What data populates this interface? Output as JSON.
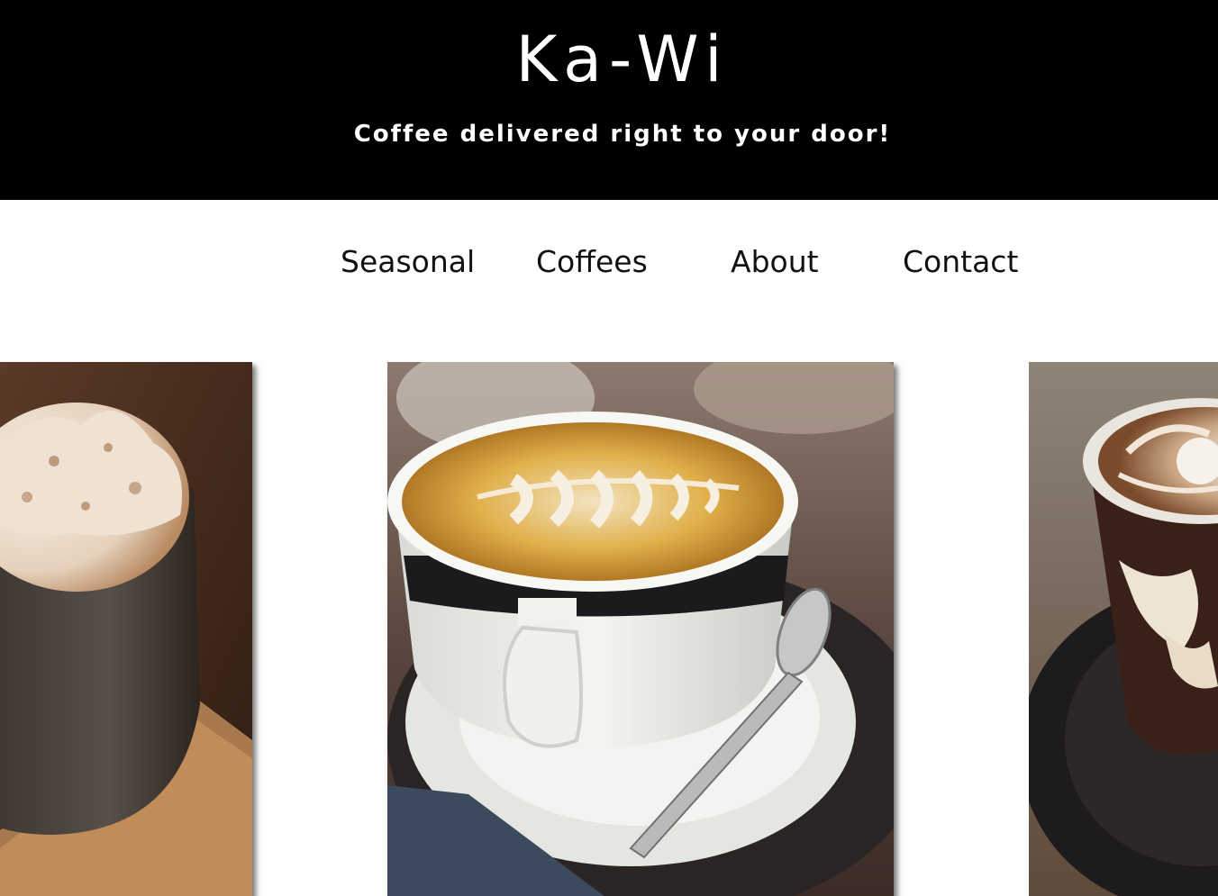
{
  "header": {
    "title": "Ka-Wi",
    "tagline": "Coffee delivered right to your door!"
  },
  "nav": {
    "items": [
      {
        "label": "Seasonal"
      },
      {
        "label": "Coffees"
      },
      {
        "label": "About"
      },
      {
        "label": "Contact"
      }
    ]
  },
  "gallery": {
    "images": [
      {
        "subject": "whipped-cream-mug"
      },
      {
        "subject": "latte-art-cup"
      },
      {
        "subject": "mocha-glass"
      }
    ]
  },
  "colors": {
    "header_bg": "#000000",
    "header_text": "#ffffff",
    "nav_text": "#111111"
  }
}
